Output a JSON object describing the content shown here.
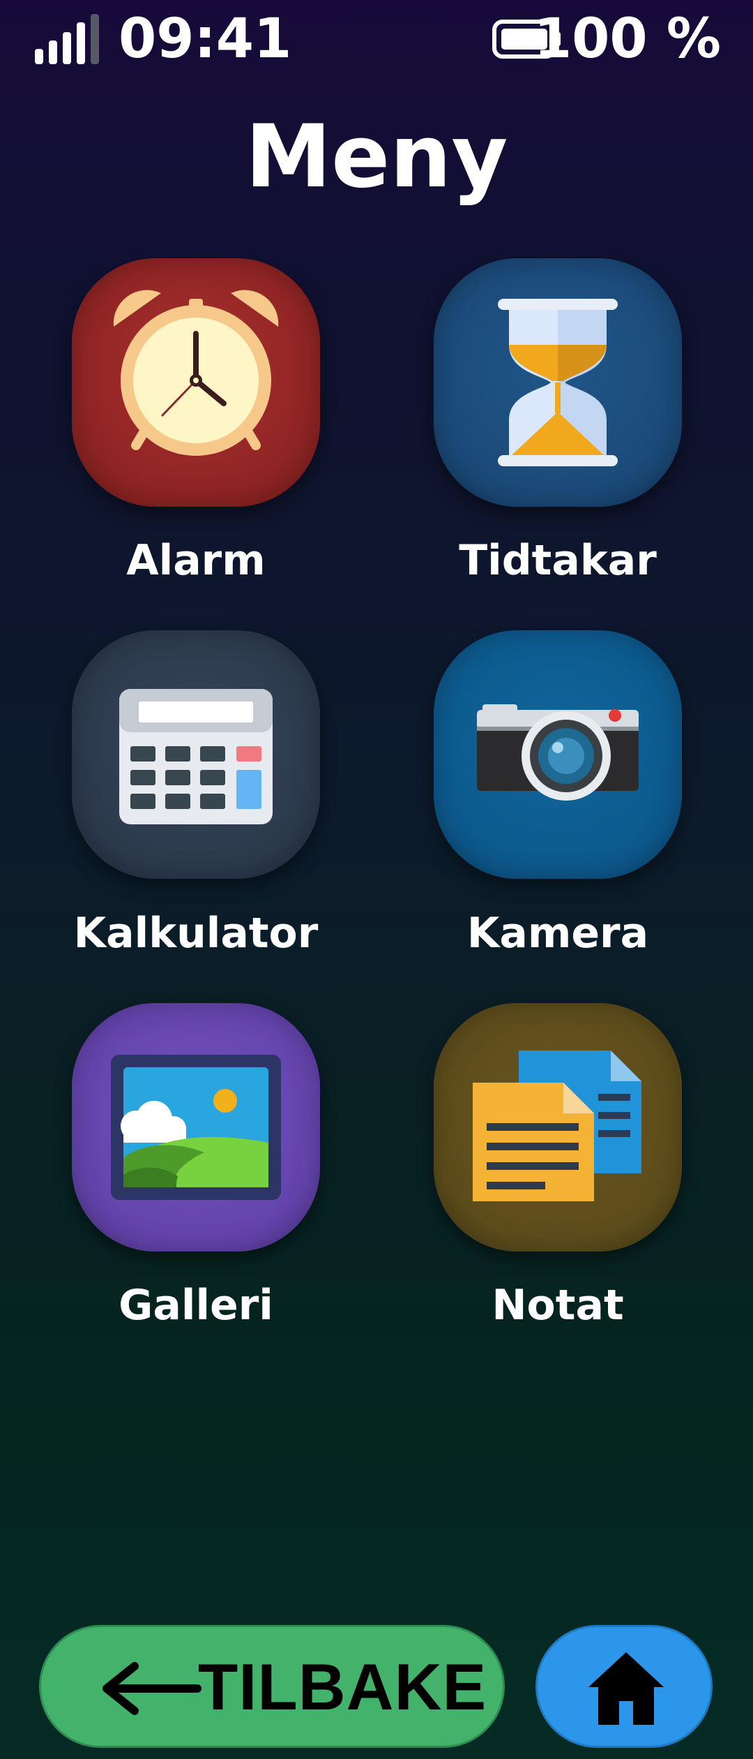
{
  "status": {
    "time": "09:41",
    "battery_text": "100 %",
    "signal_icon": "signal-bars-icon",
    "battery_icon": "battery-full-icon"
  },
  "header": {
    "title": "Meny"
  },
  "apps": [
    {
      "label": "Alarm",
      "icon": "alarm-clock-icon",
      "color": "#9b2a2a"
    },
    {
      "label": "Tidtakar",
      "icon": "hourglass-icon",
      "color": "#1d4c7a"
    },
    {
      "label": "Kalkulator",
      "icon": "calculator-icon",
      "color": "#2f3e52"
    },
    {
      "label": "Kamera",
      "icon": "camera-icon",
      "color": "#0d5a8e"
    },
    {
      "label": "Galleri",
      "icon": "picture-icon",
      "color": "#6a45b2"
    },
    {
      "label": "Notat",
      "icon": "documents-icon",
      "color": "#5e4d1c"
    }
  ],
  "nav": {
    "back_label": "TILBAKE",
    "back_icon": "arrow-left-icon",
    "home_icon": "home-icon",
    "back_color": "#43b26a",
    "home_color": "#2b96ea"
  }
}
